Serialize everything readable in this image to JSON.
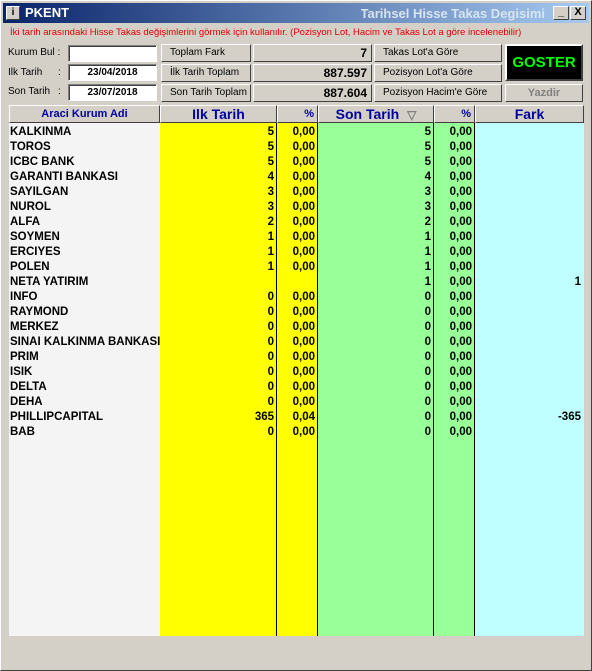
{
  "titlebar": {
    "app_name": "PKENT",
    "window_title": "Tarihsel Hisse Takas Degisimi",
    "icon_glyph": "i",
    "minimize_label": "_",
    "maximize_label": "□",
    "close_label": "X"
  },
  "info_message": "İki tarih arasındaki Hisse Takas değişimlerini görmek için kullanılır. (Pozisyon Lot, Hacim ve Takas Lot a göre incelenebilir)",
  "filters": {
    "kurum_bul_label": "Kurum Bul :",
    "kurum_bul_value": "",
    "ilk_tarih_label": "Ilk Tarih",
    "ilk_tarih_colon": ":",
    "ilk_tarih_value": "23/04/2018",
    "son_tarih_label": "Son Tarih",
    "son_tarih_colon": ":",
    "son_tarih_value": "23/07/2018"
  },
  "summary": {
    "toplam_fark_label": "Toplam Fark",
    "toplam_fark_value": "7",
    "ilk_tarih_toplam_label": "İlk Tarih Toplam",
    "ilk_tarih_toplam_value": "887.597",
    "son_tarih_toplam_label": "Son Tarih Toplam",
    "son_tarih_toplam_value": "887.604"
  },
  "modes": {
    "takas_lot": "Takas Lot'a Göre",
    "pozisyon_lot": "Pozisyon Lot'a Göre",
    "pozisyon_hacim": "Pozisyon Hacim'e Göre"
  },
  "actions": {
    "goster": "GOSTER",
    "yazdir": "Yazdir"
  },
  "colors": {
    "ilk_col": "#ffff00",
    "son_col": "#99ff99",
    "fark_col": "#bfffff",
    "name_col": "#f4f4f4"
  },
  "table": {
    "headers": {
      "name": "Araci Kurum Adi",
      "ilk": "Ilk Tarih",
      "ilk_pct": "%",
      "son": "Son Tarih",
      "son_pct": "%",
      "fark": "Fark",
      "sort_icon": "▽"
    },
    "rows": [
      {
        "name": "KALKINMA",
        "ilk": "5",
        "ilk_pct": "0,00",
        "son": "5",
        "son_pct": "0,00",
        "fark": ""
      },
      {
        "name": "TOROS",
        "ilk": "5",
        "ilk_pct": "0,00",
        "son": "5",
        "son_pct": "0,00",
        "fark": ""
      },
      {
        "name": "ICBC BANK",
        "ilk": "5",
        "ilk_pct": "0,00",
        "son": "5",
        "son_pct": "0,00",
        "fark": ""
      },
      {
        "name": "GARANTI BANKASI",
        "ilk": "4",
        "ilk_pct": "0,00",
        "son": "4",
        "son_pct": "0,00",
        "fark": ""
      },
      {
        "name": "SAYILGAN",
        "ilk": "3",
        "ilk_pct": "0,00",
        "son": "3",
        "son_pct": "0,00",
        "fark": ""
      },
      {
        "name": "NUROL",
        "ilk": "3",
        "ilk_pct": "0,00",
        "son": "3",
        "son_pct": "0,00",
        "fark": ""
      },
      {
        "name": "ALFA",
        "ilk": "2",
        "ilk_pct": "0,00",
        "son": "2",
        "son_pct": "0,00",
        "fark": ""
      },
      {
        "name": "SOYMEN",
        "ilk": "1",
        "ilk_pct": "0,00",
        "son": "1",
        "son_pct": "0,00",
        "fark": ""
      },
      {
        "name": "ERCIYES",
        "ilk": "1",
        "ilk_pct": "0,00",
        "son": "1",
        "son_pct": "0,00",
        "fark": ""
      },
      {
        "name": "POLEN",
        "ilk": "1",
        "ilk_pct": "0,00",
        "son": "1",
        "son_pct": "0,00",
        "fark": ""
      },
      {
        "name": "NETA YATIRIM",
        "ilk": "",
        "ilk_pct": "",
        "son": "1",
        "son_pct": "0,00",
        "fark": "1"
      },
      {
        "name": "INFO",
        "ilk": "0",
        "ilk_pct": "0,00",
        "son": "0",
        "son_pct": "0,00",
        "fark": ""
      },
      {
        "name": "RAYMOND",
        "ilk": "0",
        "ilk_pct": "0,00",
        "son": "0",
        "son_pct": "0,00",
        "fark": ""
      },
      {
        "name": "MERKEZ",
        "ilk": "0",
        "ilk_pct": "0,00",
        "son": "0",
        "son_pct": "0,00",
        "fark": ""
      },
      {
        "name": "SINAI KALKINMA BANKASI",
        "ilk": "0",
        "ilk_pct": "0,00",
        "son": "0",
        "son_pct": "0,00",
        "fark": ""
      },
      {
        "name": "PRIM",
        "ilk": "0",
        "ilk_pct": "0,00",
        "son": "0",
        "son_pct": "0,00",
        "fark": ""
      },
      {
        "name": "ISIK",
        "ilk": "0",
        "ilk_pct": "0,00",
        "son": "0",
        "son_pct": "0,00",
        "fark": ""
      },
      {
        "name": "DELTA",
        "ilk": "0",
        "ilk_pct": "0,00",
        "son": "0",
        "son_pct": "0,00",
        "fark": ""
      },
      {
        "name": "DEHA",
        "ilk": "0",
        "ilk_pct": "0,00",
        "son": "0",
        "son_pct": "0,00",
        "fark": ""
      },
      {
        "name": "PHILLIPCAPITAL",
        "ilk": "365",
        "ilk_pct": "0,04",
        "son": "0",
        "son_pct": "0,00",
        "fark": "-365"
      },
      {
        "name": "BAB",
        "ilk": "0",
        "ilk_pct": "0,00",
        "son": "0",
        "son_pct": "0,00",
        "fark": ""
      }
    ]
  }
}
